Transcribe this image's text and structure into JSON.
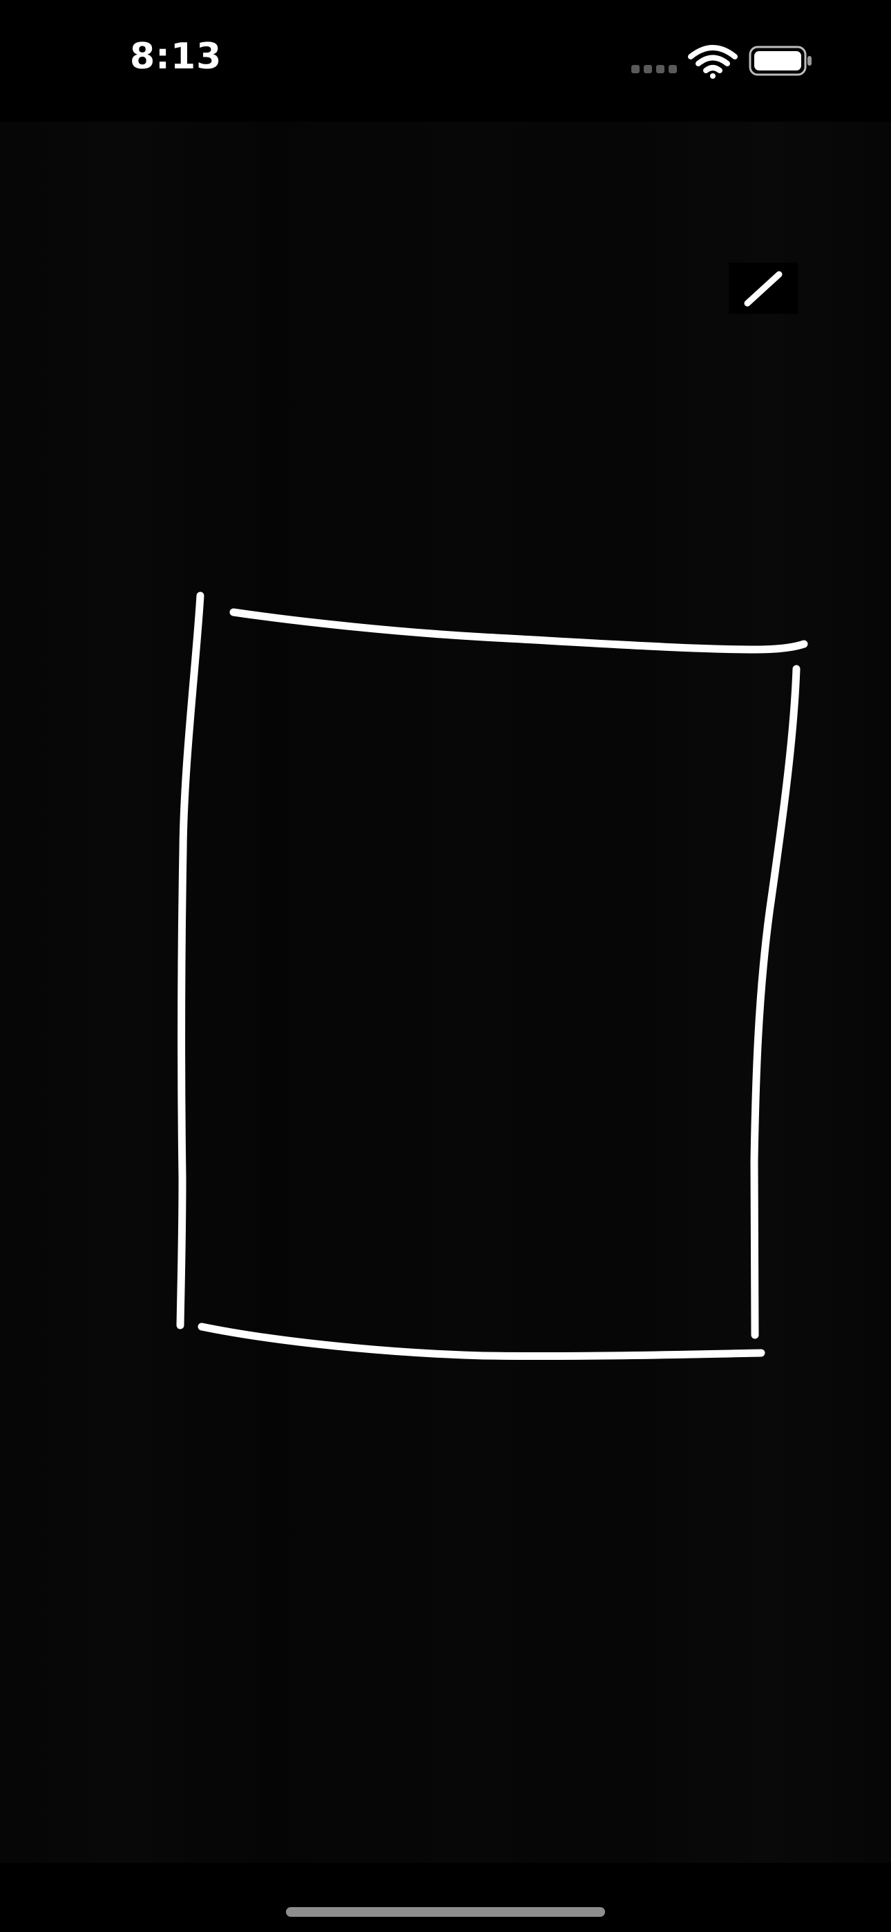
{
  "status_bar": {
    "time": "8:13",
    "signal_icon": "cellular-signal-icon",
    "wifi_icon": "wifi-icon",
    "battery_icon": "battery-icon"
  },
  "toolbar": {
    "tool_icon": "pen-tool-icon"
  },
  "canvas": {
    "stroke_color": "#ffffff",
    "background_color": "#060606",
    "shape": "hand-drawn-rectangle"
  }
}
